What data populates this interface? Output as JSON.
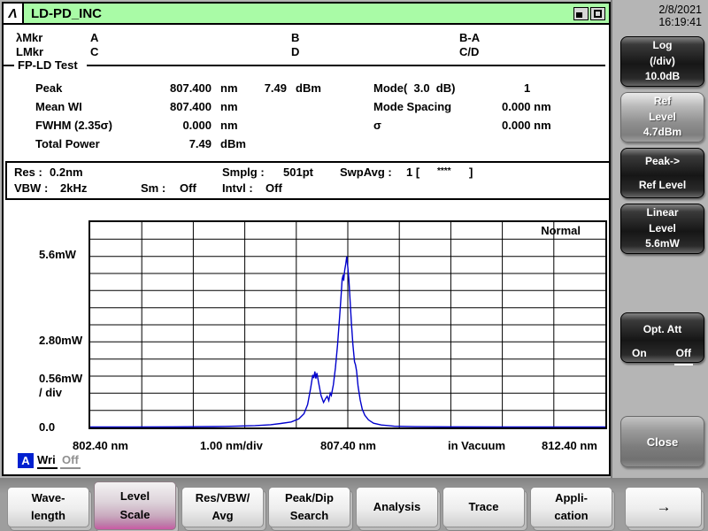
{
  "window": {
    "logo_glyph": "Λ",
    "title": "LD-PD_INC"
  },
  "datetime": {
    "date": "2/8/2021",
    "time": "16:19:41"
  },
  "markers": {
    "wl_label": "λMkr",
    "wl_a": "A",
    "wl_b": "B",
    "wl_diff": "B-A",
    "lv_label": "LMkr",
    "lv_c": "C",
    "lv_d": "D",
    "lv_ratio": "C/D"
  },
  "analysis_section": {
    "title": "FP-LD Test",
    "peak_label": "Peak",
    "peak_wl": "807.400",
    "peak_wl_unit": "nm",
    "peak_pw": "7.49",
    "peak_pw_unit": "dBm",
    "mean_label": "Mean WI",
    "mean_wl": "807.400",
    "mean_unit": "nm",
    "fwhm_label": "FWHM (2.35σ)",
    "fwhm_val": "0.000",
    "fwhm_unit": "nm",
    "total_label": "Total Power",
    "total_val": "7.49",
    "total_unit": "dBm",
    "mode_label": "Mode(  3.0  dB)",
    "mode_val": "1",
    "spacing_label": "Mode Spacing",
    "spacing_val": "0.000 nm",
    "sigma_label": "σ",
    "sigma_val": "0.000 nm"
  },
  "settings": {
    "res_label": "Res :",
    "res_val": "0.2nm",
    "smplg_label": "Smplg :",
    "smplg_val": "501pt",
    "swpavg_label": "SwpAvg :",
    "swpavg_pre": "1 [",
    "swpavg_stars": "****",
    "swpavg_post": "]",
    "vbw_label": "VBW :",
    "vbw_val": "2kHz",
    "sm_label": "Sm :",
    "sm_val": "Off",
    "intvl_label": "Intvl :",
    "intvl_val": "Off"
  },
  "trace_status": {
    "trace": "A",
    "mode": "Wri",
    "state": "Off"
  },
  "chart_data": {
    "type": "line",
    "mode_label": "Normal",
    "x_min": 802.4,
    "x_max": 812.4,
    "y_min": 0,
    "y_max": 6.72,
    "y_mw_per_div": 0.56,
    "grid_cols": 10,
    "grid_rows": 12,
    "trace_color": "#0000cc",
    "y_axis_labels": {
      "top": "5.6mW",
      "mid": "2.80mW",
      "div": "0.56mW",
      "div2": "/ div",
      "zero": "0.0"
    },
    "x_axis_labels": {
      "start": "802.40 nm",
      "per_div": "1.00 nm/div",
      "center": "807.40 nm",
      "medium": "in Vacuum",
      "end": "812.40 nm"
    },
    "points": [
      [
        802.4,
        0.015
      ],
      [
        803.2,
        0.015
      ],
      [
        804.0,
        0.02
      ],
      [
        804.8,
        0.03
      ],
      [
        805.2,
        0.04
      ],
      [
        805.6,
        0.06
      ],
      [
        805.9,
        0.09
      ],
      [
        806.1,
        0.13
      ],
      [
        806.3,
        0.18
      ],
      [
        806.45,
        0.28
      ],
      [
        806.55,
        0.45
      ],
      [
        806.62,
        0.75
      ],
      [
        806.68,
        1.3
      ],
      [
        806.72,
        1.72
      ],
      [
        806.74,
        1.62
      ],
      [
        806.76,
        1.83
      ],
      [
        806.78,
        1.6
      ],
      [
        806.8,
        1.78
      ],
      [
        806.83,
        1.5
      ],
      [
        806.88,
        1.05
      ],
      [
        806.93,
        0.82
      ],
      [
        806.97,
        0.95
      ],
      [
        807.0,
        1.02
      ],
      [
        807.03,
        0.88
      ],
      [
        807.06,
        1.12
      ],
      [
        807.08,
        1.05
      ],
      [
        807.12,
        1.4
      ],
      [
        807.16,
        1.95
      ],
      [
        807.2,
        2.7
      ],
      [
        807.24,
        3.6
      ],
      [
        807.27,
        4.3
      ],
      [
        807.29,
        4.85
      ],
      [
        807.31,
        5.0
      ],
      [
        807.32,
        4.8
      ],
      [
        807.34,
        5.15
      ],
      [
        807.36,
        5.35
      ],
      [
        807.38,
        5.6
      ],
      [
        807.4,
        5.25
      ],
      [
        807.42,
        4.85
      ],
      [
        807.44,
        4.3
      ],
      [
        807.47,
        3.4
      ],
      [
        807.5,
        2.7
      ],
      [
        807.53,
        2.15
      ],
      [
        807.55,
        2.05
      ],
      [
        807.57,
        1.85
      ],
      [
        807.6,
        1.35
      ],
      [
        807.64,
        0.9
      ],
      [
        807.68,
        0.6
      ],
      [
        807.73,
        0.4
      ],
      [
        807.8,
        0.25
      ],
      [
        807.9,
        0.14
      ],
      [
        808.05,
        0.08
      ],
      [
        808.3,
        0.04
      ],
      [
        808.7,
        0.025
      ],
      [
        809.5,
        0.02
      ],
      [
        810.5,
        0.015
      ],
      [
        812.4,
        0.015
      ]
    ]
  },
  "sidebar": {
    "log_btn": "Log\n(/div)\n10.0dB",
    "ref_level_btn": "Ref\nLevel\n4.7dBm",
    "peak_ref_btn": "Peak->\nRef Level",
    "linear_level_btn": "Linear\nLevel\n5.6mW",
    "opt_att": {
      "title": "Opt. Att",
      "on": "On",
      "off": "Off"
    },
    "close_btn": "Close"
  },
  "bottom_menu": {
    "wavelength": "Wave-\nlength",
    "level_scale": "Level\nScale",
    "res_vbw_avg": "Res/VBW/\nAvg",
    "peak_dip": "Peak/Dip\nSearch",
    "analysis": "Analysis",
    "trace": "Trace",
    "application": "Appli-\ncation",
    "next_arrow": "→"
  }
}
